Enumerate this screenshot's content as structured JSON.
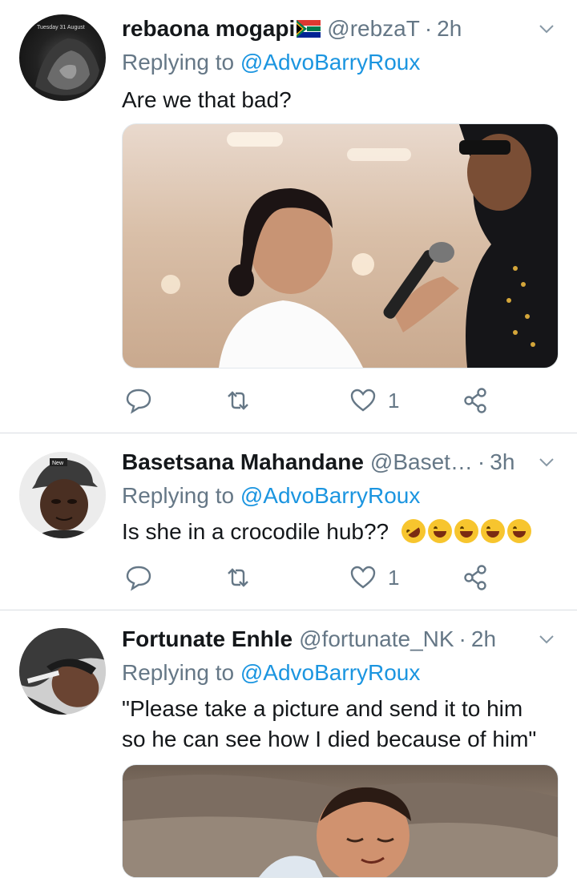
{
  "tweets": [
    {
      "name": "rebaona mogapi",
      "handle": "@rebzaT",
      "time": "2h",
      "reply_prefix": "Replying to",
      "reply_to": "@AdvoBarryRoux",
      "text": "Are we that bad?",
      "likes": "1",
      "avatar_text": "Tuesday 31 August",
      "flag": "south-africa-flag"
    },
    {
      "name": "Basetsana Mahandane",
      "handle": "@Baset…",
      "time": "3h",
      "reply_prefix": "Replying to",
      "reply_to": "@AdvoBarryRoux",
      "text": "Is she in a crocodile hub??",
      "likes": "1",
      "avatar_text": "New"
    },
    {
      "name": "Fortunate Enhle",
      "handle": "@fortunate_NK",
      "time": "2h",
      "reply_prefix": "Replying to",
      "reply_to": "@AdvoBarryRoux",
      "text_line1": "\"Please take a picture and send it to him",
      "text_line2": "so he can see how I died because of him\""
    }
  ],
  "colors": {
    "name": "#14171a",
    "muted": "#657786",
    "mention": "#1b95e0",
    "divider": "#d9dde2"
  }
}
